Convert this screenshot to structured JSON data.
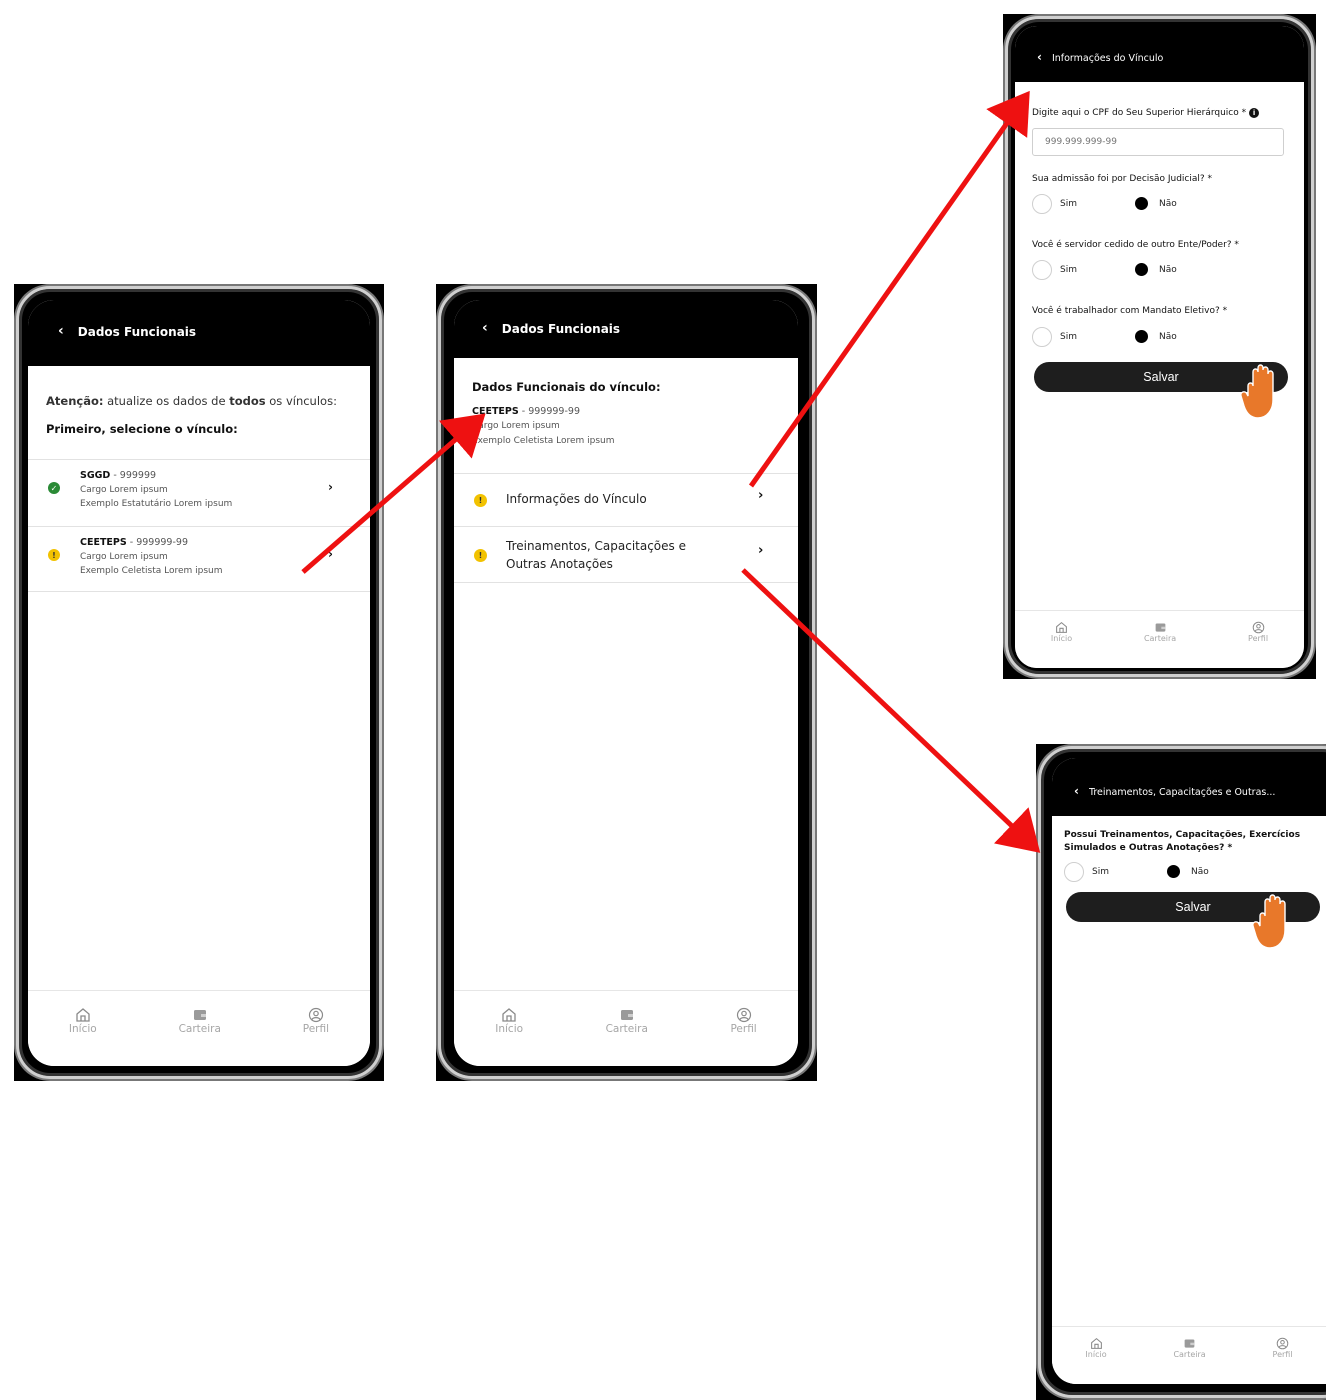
{
  "phone1": {
    "title": "Dados Funcionais",
    "attention_bold": "Atenção:",
    "attention_pre": " atualize os dados de ",
    "attention_bold2": "todos",
    "attention_post": " os vínculos:",
    "select_prompt": "Primeiro, selecione o vínculo:",
    "items": [
      {
        "code": "SGGD",
        "number": " - 999999",
        "role": "Cargo Lorem ipsum",
        "type": "Exemplo Estatutário Lorem ipsum",
        "status": "ok"
      },
      {
        "code": "CEETEPS",
        "number": " - 999999-99",
        "role": "Cargo Lorem ipsum",
        "type": "Exemplo Celetista Lorem ipsum",
        "status": "warning"
      }
    ]
  },
  "phone2": {
    "title": "Dados Funcionais",
    "heading": "Dados Funcionais do vínculo:",
    "link_code": "CEETEPS",
    "link_number": " - 999999-99",
    "link_role": "Cargo Lorem ipsum",
    "link_type": "Exemplo Celetista Lorem ipsum",
    "menu": [
      {
        "label": "Informações do Vínculo"
      },
      {
        "label": "Treinamentos, Capacitações e Outras Anotações"
      }
    ]
  },
  "phone3": {
    "title": "Informações do Vínculo",
    "cpf_label": "Digite aqui o CPF do Seu Superior Hierárquico *",
    "cpf_placeholder": "999.999.999-99",
    "questions": [
      {
        "text": "Sua admissão foi por Decisão Judicial? *",
        "selected": "Não"
      },
      {
        "text": "Você é servidor cedido de outro Ente/Poder? *",
        "selected": "Não"
      },
      {
        "text": "Você é trabalhador com Mandato Eletivo? *",
        "selected": "Não"
      }
    ],
    "yes": "Sim",
    "no": "Não",
    "save": "Salvar"
  },
  "phone4": {
    "title": "Treinamentos, Capacitações e Outras...",
    "question_line1": "Possui Treinamentos, Capacitações, Exercícios",
    "question_line2": "Simulados e Outras Anotações? *",
    "yes": "Sim",
    "no": "Não",
    "selected": "Não",
    "save": "Salvar"
  },
  "nav": {
    "home": "Início",
    "wallet": "Carteira",
    "profile": "Perfil"
  },
  "colors": {
    "arrow": "#ee1111",
    "hand": "#e8782a",
    "ok": "#2a8a36",
    "warning": "#f2c200"
  }
}
